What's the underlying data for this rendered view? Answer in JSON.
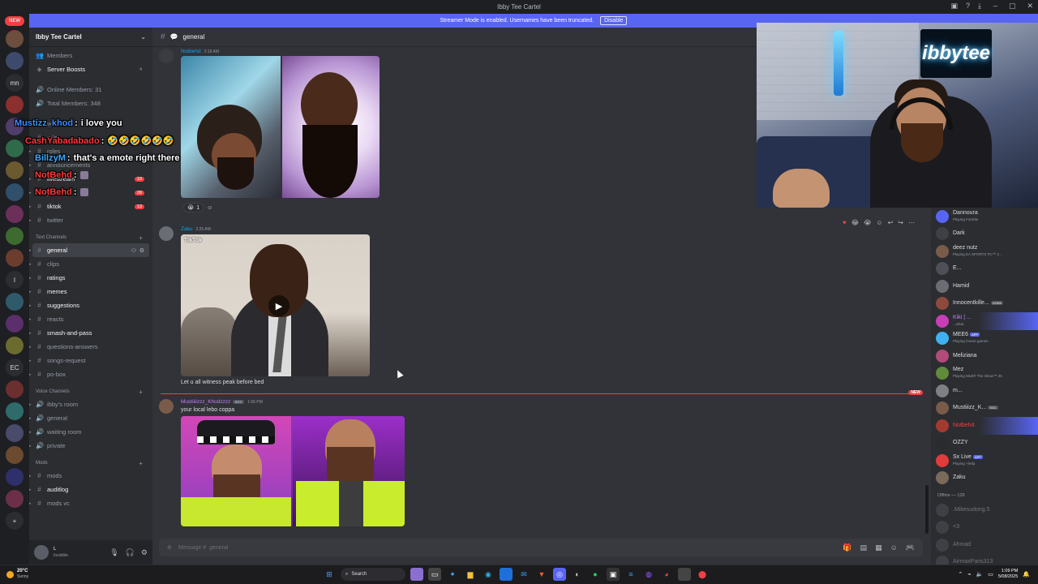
{
  "window": {
    "title": "Ibby Tee Cartel",
    "controls": [
      "–",
      "▢",
      "✕"
    ]
  },
  "banner": {
    "text": "Streamer Mode is enabled. Usernames have been truncated.",
    "button": "Disable"
  },
  "rail": {
    "new_label": "NEW",
    "servers": [
      {
        "label": "",
        "badge": ""
      },
      {
        "label": "",
        "badge": ""
      },
      {
        "label": "mn",
        "badge": ""
      },
      {
        "label": "",
        "badge": ""
      },
      {
        "label": "",
        "badge": ""
      },
      {
        "label": "",
        "badge": ""
      },
      {
        "label": "",
        "badge": ""
      },
      {
        "label": "",
        "badge": ""
      },
      {
        "label": "",
        "badge": ""
      },
      {
        "label": "",
        "badge": ""
      },
      {
        "label": "",
        "badge": ""
      },
      {
        "label": "I",
        "badge": ""
      },
      {
        "label": "",
        "badge": ""
      },
      {
        "label": "",
        "badge": ""
      },
      {
        "label": "",
        "badge": ""
      },
      {
        "label": "EC",
        "badge": ""
      },
      {
        "label": "",
        "badge": ""
      },
      {
        "label": "",
        "badge": ""
      },
      {
        "label": "",
        "badge": ""
      },
      {
        "label": "",
        "badge": ""
      },
      {
        "label": "",
        "badge": ""
      },
      {
        "label": "",
        "badge": ""
      },
      {
        "label": "+",
        "badge": ""
      }
    ]
  },
  "sidebar": {
    "server_name": "Ibby Tee Cartel",
    "top_items": [
      {
        "label": "Members",
        "badge": ""
      },
      {
        "label": "Server Boosts",
        "badge": "4"
      }
    ],
    "stats": [
      {
        "label": "Online Members: 31"
      },
      {
        "label": "Total Members: 348"
      }
    ],
    "info_items": [
      {
        "label": "welcome"
      },
      {
        "label": "rules"
      },
      {
        "label": "roles"
      },
      {
        "label": "announcements"
      }
    ],
    "social_items": [
      {
        "label": "livestream",
        "badge": "19"
      },
      {
        "label": "youtube",
        "badge": "28"
      },
      {
        "label": "tiktok",
        "badge": "13"
      },
      {
        "label": "twitter",
        "badge": ""
      }
    ],
    "text_category": "Text Channels",
    "text_channels": [
      {
        "label": "general",
        "active": true
      },
      {
        "label": "clips"
      },
      {
        "label": "ratings"
      },
      {
        "label": "memes"
      },
      {
        "label": "suggestions"
      },
      {
        "label": "reacts"
      },
      {
        "label": "smash-and-pass"
      },
      {
        "label": "questions-answers"
      },
      {
        "label": "songs-request"
      },
      {
        "label": "po-box"
      }
    ],
    "voice_category": "Voice Channels",
    "voice_channels": [
      {
        "label": "ibby's room"
      },
      {
        "label": "general"
      },
      {
        "label": "waiting room"
      },
      {
        "label": "private"
      }
    ],
    "mods_category": "Mods",
    "mod_channels": [
      {
        "label": "mods"
      },
      {
        "label": "auditlog"
      },
      {
        "label": "mods vc"
      }
    ],
    "user": {
      "name": "L",
      "status": "Invisible"
    }
  },
  "chat": {
    "channel_name": "general",
    "messages": [
      {
        "author": "Notbehd",
        "time": "2:19 AM",
        "reaction_count": "1"
      },
      {
        "author": "Zaku",
        "time": "2:25 AM",
        "text": "Let u all witness peak before bed",
        "video_label": "TikTok"
      },
      {
        "author": "Mustiiiizzz_Khodzzzz",
        "tag": "SGC",
        "time": "1:06 PM",
        "text": "your local lebo coppa"
      }
    ],
    "new_label": "NEW",
    "composer_placeholder": "Message #  general"
  },
  "overlay": {
    "lines": [
      {
        "user": "Mustizz_khod",
        "color": "#3f8cff",
        "text": "i love you"
      },
      {
        "user": "CashYabadabado",
        "color": "#ff3b3b",
        "text": "🤣🤣🤣🤣🤣🤣"
      },
      {
        "user": "BillzyM",
        "color": "#3fa9ff",
        "text": "that's a emote right there"
      },
      {
        "user": "NotBehd",
        "color": "#ff3b3b",
        "text": ""
      },
      {
        "user": "NotBehd",
        "color": "#ff3b3b",
        "text": ""
      }
    ]
  },
  "webcam": {
    "neon_text": "ibbytee"
  },
  "members": {
    "online": [
      {
        "name": "Dannoura",
        "status": "Playing Fortnite"
      },
      {
        "name": "Dark",
        "status": ""
      },
      {
        "name": "deez nutz",
        "status": "Playing EA SPORTS FC™ 2..."
      },
      {
        "name": "E...",
        "status": ""
      },
      {
        "name": "Hamid",
        "status": ""
      },
      {
        "name": "Innocentkille...",
        "status": "",
        "tag": "DGEN"
      },
      {
        "name": "Kiki | ...",
        "status": "...what",
        "highlight": true
      },
      {
        "name": "MEE6",
        "status": "Playing /meee-games",
        "app": "APP"
      },
      {
        "name": "Meliziana",
        "status": ""
      },
      {
        "name": "Mez",
        "status": "Playing MLB® The Show™ 25"
      },
      {
        "name": "m...",
        "status": ""
      },
      {
        "name": "Mustiiizz_K...",
        "status": "",
        "tag": "SGC"
      },
      {
        "name": "Notbehd",
        "status": "",
        "highlight": true
      },
      {
        "name": "OZZY",
        "status": ""
      },
      {
        "name": "Sx Live",
        "status": "Playing +help",
        "app": "APP"
      },
      {
        "name": "Zaku",
        "status": ""
      }
    ],
    "offline_header": "Offline — 128",
    "offline": [
      {
        "name": ".Mikesudong.5"
      },
      {
        "name": "<3"
      },
      {
        "name": "Ahmad"
      },
      {
        "name": "AirmaxParis313"
      }
    ]
  },
  "taskbar": {
    "weather_temp": "20°C",
    "weather_desc": "Sunny",
    "search_label": "Search",
    "time": "1:09 PM",
    "date": "5/08/2025"
  }
}
